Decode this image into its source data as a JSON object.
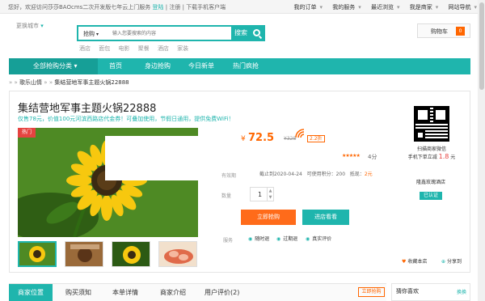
{
  "topbar": {
    "greeting": "您好，欢迎访问莎莎BAOcms二次开发版七年云上门服务",
    "login": "登陆",
    "sep": "|",
    "register": "注册",
    "download": "下载手机客户端",
    "links": [
      "我的订单",
      "我的服务",
      "最近浏览",
      "我是商家",
      "网站导航"
    ]
  },
  "header": {
    "city": "更换城市",
    "search_category": "抢购",
    "search_placeholder": "输入您要搜索的内容",
    "search_button": "搜索",
    "hot_words": [
      "酒店",
      "面包",
      "电影",
      "聚餐",
      "酒店",
      "家装"
    ],
    "cart_label": "购物车",
    "cart_count": "0"
  },
  "nav": {
    "all": "全部抢购分类",
    "items": [
      "首页",
      "身边抢购",
      "今日新单",
      "热门疯抢"
    ]
  },
  "breadcrumb": {
    "prefix": "»",
    "cat": "歌乐山情",
    "current": "集结营地军事主题火锅22888"
  },
  "product": {
    "title": "集结营地军事主题火锅22888",
    "subtitle": "仅售78元，价值100元河滨西路店代金券！可叠加使用，节假日通用，提供免费WiFi！",
    "hot_badge": "热门",
    "currency": "¥",
    "price": "72.5",
    "original": "¥328",
    "discount": "2.2折",
    "score": "4分",
    "valid_label": "有效期",
    "valid_text": "截止到2020-04-24",
    "points_text": "可使用积分：200",
    "rebate_label": "抵现：",
    "rebate_value": "2元",
    "qty_label": "数量",
    "qty": "1",
    "buy_button": "立即抢购",
    "store_button": "进店看看",
    "service_label": "服务",
    "services": [
      "随时退",
      "过期退",
      "真实评价"
    ]
  },
  "side": {
    "qr_text": "扫描商家微信",
    "mobile_prefix": "手机下单立减",
    "mobile_amount": "1.8",
    "mobile_unit": "元",
    "shop_name": "隆鑫玫瑰酒店",
    "auth": "已认证",
    "fav": "收藏本店",
    "share": "分享到"
  },
  "tabs": {
    "items": [
      "商家位置",
      "购买须知",
      "本单详情",
      "商家介绍",
      "用户评价(2)"
    ],
    "buy": "立即抢购"
  },
  "guess": {
    "title": "猜你喜欢",
    "change": "换换"
  },
  "colors": {
    "accent": "#1fb5ad",
    "orange": "#ff6b1a",
    "red": "#e64340"
  }
}
